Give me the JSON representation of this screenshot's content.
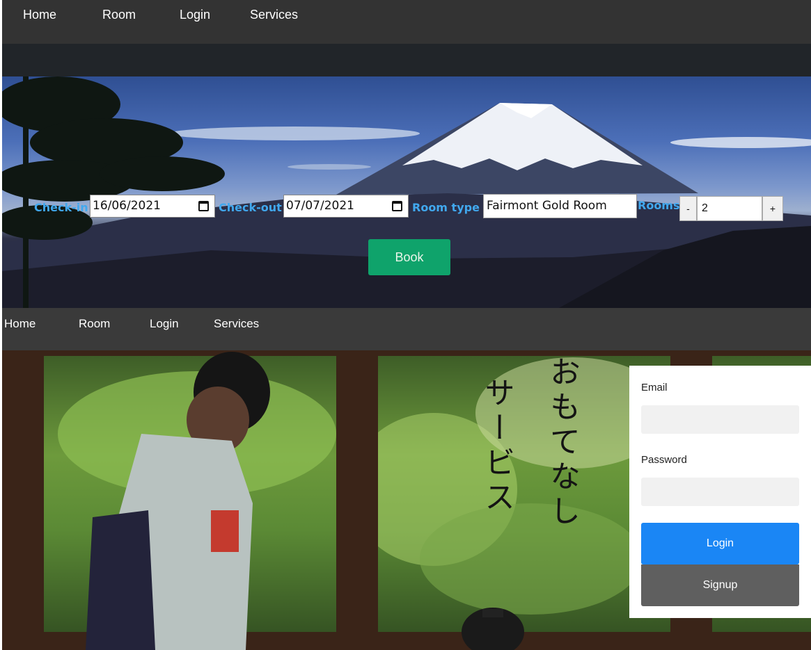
{
  "nav_top": {
    "items": [
      "Home",
      "Room",
      "Login",
      "Services"
    ]
  },
  "booking": {
    "checkin_label": "Check-in",
    "checkin_value": "16/06/2021",
    "checkout_label": "Check-out",
    "checkout_value": "07/07/2021",
    "roomtype_label": "Room type",
    "roomtype_value": "Fairmont Gold Room",
    "rooms_label": "Rooms",
    "minus_label": "-",
    "rooms_value": "2",
    "plus_label": "+",
    "book_label": "Book"
  },
  "nav_second": {
    "items": [
      "Home",
      "Room",
      "Login",
      "Services"
    ]
  },
  "hero_text": {
    "line1": "おもてなし",
    "line2": "サービス"
  },
  "login": {
    "email_label": "Email",
    "email_value": "",
    "password_label": "Password",
    "password_value": "",
    "login_label": "Login",
    "signup_label": "Signup"
  },
  "colors": {
    "nav_bg": "#333333",
    "label_blue": "#41a8ee",
    "book_green": "#0fa36b",
    "login_blue": "#1a86f5",
    "signup_gray": "#5f5f5f"
  }
}
